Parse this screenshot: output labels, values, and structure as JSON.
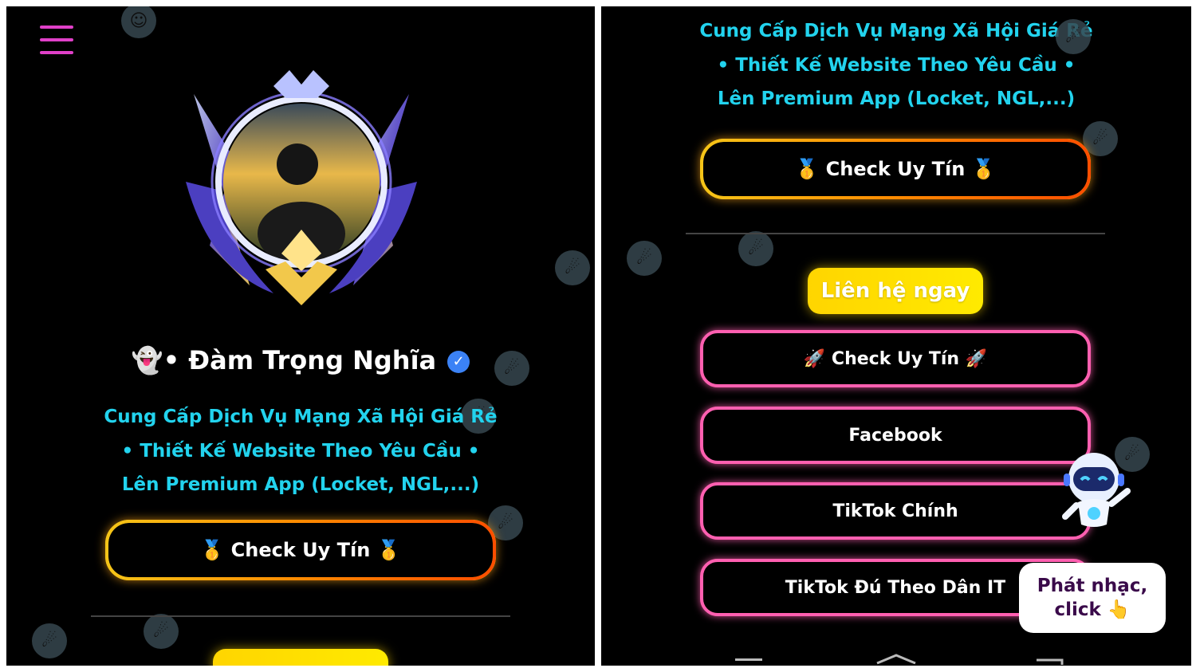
{
  "left": {
    "display_name": "👻• Đàm Trọng Nghĩa",
    "verified_mark": "✓",
    "bio_lines": [
      "Cung Cấp Dịch Vụ Mạng Xã Hội Giá Rẻ",
      "• Thiết Kế Website Theo Yêu Cầu •",
      "Lên Premium App (Locket, NGL,...)"
    ],
    "check_button": "🥇 Check Uy Tín 🥇"
  },
  "right": {
    "bio_lines": [
      "Cung Cấp Dịch Vụ Mạng Xã Hội Giá Rẻ",
      "• Thiết Kế Website Theo Yêu Cầu •",
      "Lên Premium App (Locket, NGL,...)"
    ],
    "check_button": "🥇 Check Uy Tín 🥇",
    "contact_label": "Liên hệ ngay",
    "links": [
      "🚀 Check Uy Tín 🚀",
      "Facebook",
      "TikTok Chính",
      "TikTok Đú Theo Dân IT"
    ],
    "music_popup": [
      "Phát nhạc,",
      "click 👆"
    ]
  },
  "colors": {
    "accent_cyan": "#22d3ee",
    "menu_pink": "#e040c8",
    "link_border_pink": "#ff5fb0",
    "gold": "#f5c518",
    "contact_yellow": "#ffd500"
  },
  "icons": [
    "hamburger-menu-icon",
    "verified-badge-icon",
    "avatar-frame",
    "robot-mascot-icon",
    "floating-bubble-icon",
    "nav-menu-icon",
    "nav-home-icon",
    "nav-back-icon"
  ]
}
